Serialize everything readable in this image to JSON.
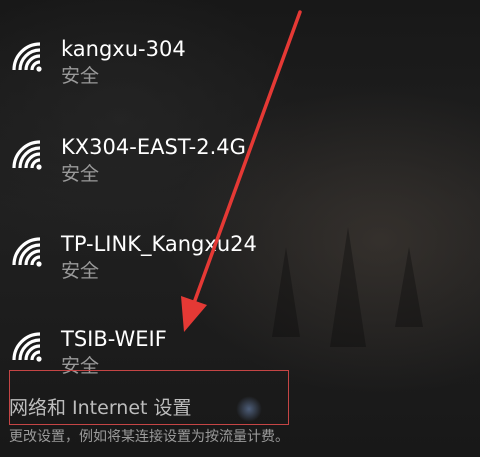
{
  "networks": [
    {
      "name": "kangxu-304",
      "status": "安全"
    },
    {
      "name": "KX304-EAST-2.4G",
      "status": "安全"
    },
    {
      "name": "TP-LINK_Kangxu24",
      "status": "安全"
    },
    {
      "name": "TSIB-WEIF",
      "status": "安全"
    }
  ],
  "settings": {
    "title": "网络和 Internet 设置",
    "description": "更改设置，例如将某连接设置为按流量计费。"
  },
  "colors": {
    "text": "#ffffff",
    "subtext": "#9a9a9a",
    "highlight_box": "#c54545",
    "arrow": "#e53935"
  },
  "icons": {
    "network": "wifi-icon"
  }
}
